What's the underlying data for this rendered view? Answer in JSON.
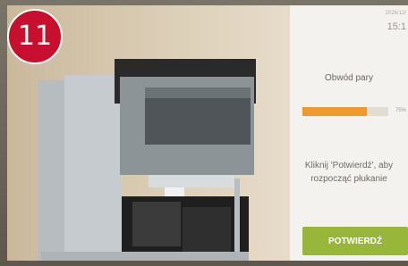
{
  "step": {
    "number": "11"
  },
  "status": {
    "date": "2026/12/",
    "time": "15:1"
  },
  "process": {
    "title": "Obwód pary",
    "progress": 75,
    "progress_label": "75%"
  },
  "instruction": {
    "text": "Kliknij 'Potwierdź', aby rozpocząć płukanie"
  },
  "actions": {
    "confirm_label": "POTWIERDŹ"
  },
  "colors": {
    "badge": "#c8102e",
    "progress_fill": "#ef9a2e",
    "confirm_button": "#98b73a"
  },
  "icons": {
    "machine_illustration": "coffee-machine-illustration"
  }
}
